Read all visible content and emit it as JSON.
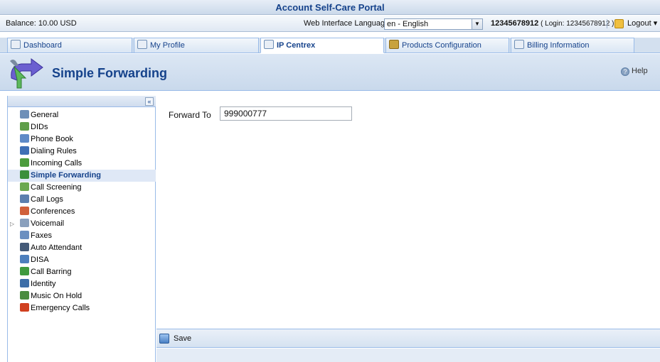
{
  "app": {
    "title": "Account Self-Care Portal"
  },
  "info_bar": {
    "balance": "Balance: 10.00 USD",
    "language_label": "Web Interface Language:",
    "language_value": "en - English",
    "account_number": "12345678912",
    "account_login": "( Login: 12345678912 )",
    "logout_label": "Logout"
  },
  "tabs": [
    {
      "label": "Dashboard",
      "icon": "dashboard-icon"
    },
    {
      "label": "My Profile",
      "icon": "profile-icon"
    },
    {
      "label": "IP Centrex",
      "icon": "ip-centrex-icon",
      "active": true
    },
    {
      "label": "Products Configuration",
      "icon": "products-icon"
    },
    {
      "label": "Billing Information",
      "icon": "billing-icon"
    }
  ],
  "header": {
    "title": "Simple Forwarding",
    "help_label": "Help"
  },
  "sidebar": {
    "collapse_label": "«",
    "items": [
      {
        "label": "General",
        "icon": "general-icon",
        "color": "#6d8fb8"
      },
      {
        "label": "DIDs",
        "icon": "dids-icon",
        "color": "#5f9e4a"
      },
      {
        "label": "Phone Book",
        "icon": "phone-book-icon",
        "color": "#5e8ac7"
      },
      {
        "label": "Dialing Rules",
        "icon": "dialing-rules-icon",
        "color": "#3f6fb5"
      },
      {
        "label": "Incoming Calls",
        "icon": "incoming-calls-icon",
        "color": "#4c9c3e"
      },
      {
        "label": "Simple Forwarding",
        "icon": "simple-forwarding-icon",
        "color": "#3b8f3b",
        "selected": true
      },
      {
        "label": "Call Screening",
        "icon": "call-screening-icon",
        "color": "#6aa84f"
      },
      {
        "label": "Call Logs",
        "icon": "call-logs-icon",
        "color": "#5b7fae"
      },
      {
        "label": "Conferences",
        "icon": "conferences-icon",
        "color": "#d0603a"
      },
      {
        "label": "Voicemail",
        "icon": "voicemail-icon",
        "color": "#8aa0bd",
        "expandable": true
      },
      {
        "label": "Faxes",
        "icon": "faxes-icon",
        "color": "#6b8fc0"
      },
      {
        "label": "Auto Attendant",
        "icon": "auto-attendant-icon",
        "color": "#445a78"
      },
      {
        "label": "DISA",
        "icon": "disa-icon",
        "color": "#4d7fbd"
      },
      {
        "label": "Call Barring",
        "icon": "call-barring-icon",
        "color": "#3f9a3f"
      },
      {
        "label": "Identity",
        "icon": "identity-icon",
        "color": "#3d6ea8"
      },
      {
        "label": "Music On Hold",
        "icon": "music-on-hold-icon",
        "color": "#4a8c3f"
      },
      {
        "label": "Emergency Calls",
        "icon": "emergency-calls-icon",
        "color": "#d04020"
      }
    ]
  },
  "form": {
    "forward_to_label": "Forward To",
    "forward_to_value": "999000777"
  },
  "footer": {
    "save_label": "Save"
  }
}
